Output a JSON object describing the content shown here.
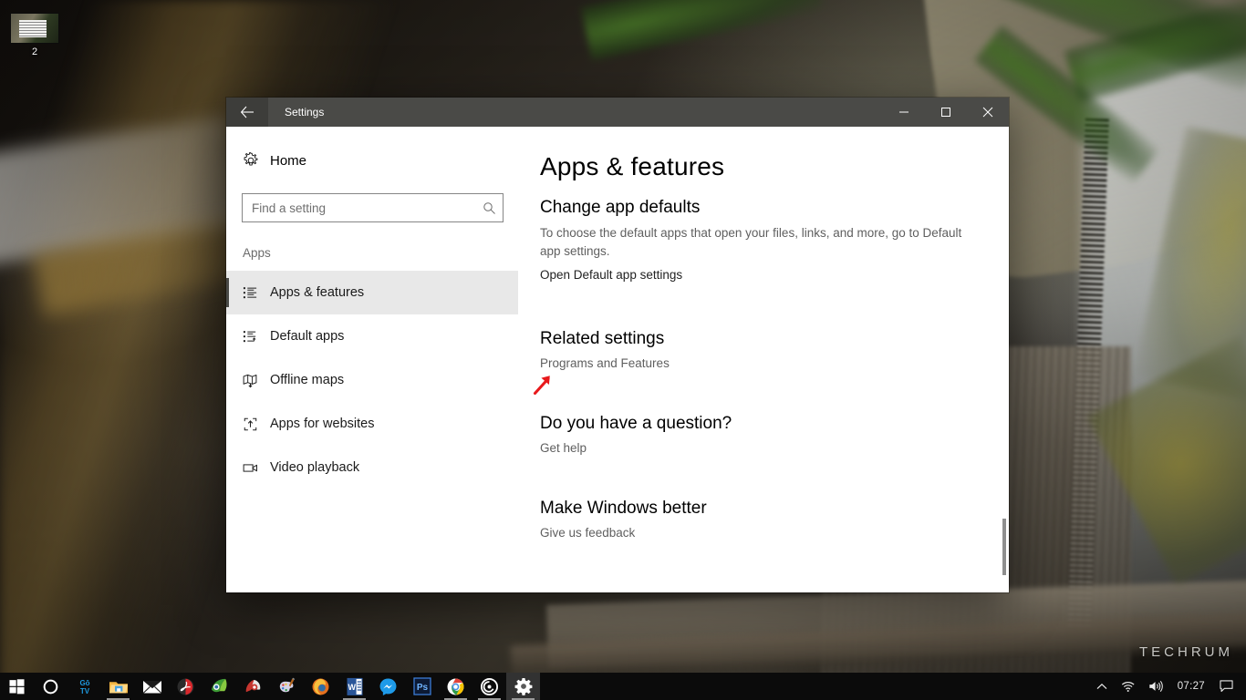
{
  "desktop": {
    "icon": {
      "label": "2",
      "name": "image-thumbnail"
    },
    "watermark": "TECHRUM"
  },
  "window": {
    "title": "Settings",
    "back_tooltip": "Back",
    "minimize_tooltip": "Minimize",
    "maximize_tooltip": "Maximize",
    "close_tooltip": "Close"
  },
  "sidebar": {
    "home_label": "Home",
    "search": {
      "placeholder": "Find a setting",
      "value": ""
    },
    "group_label": "Apps",
    "items": [
      {
        "label": "Apps & features",
        "icon": "list-icon",
        "selected": true
      },
      {
        "label": "Default apps",
        "icon": "list-arrow-icon",
        "selected": false
      },
      {
        "label": "Offline maps",
        "icon": "map-download-icon",
        "selected": false
      },
      {
        "label": "Apps for websites",
        "icon": "box-arrow-up-icon",
        "selected": false
      },
      {
        "label": "Video playback",
        "icon": "video-camera-icon",
        "selected": false
      }
    ]
  },
  "content": {
    "page_title": "Apps & features",
    "sections": [
      {
        "heading": "Change app defaults",
        "body": "To choose the default apps that open your files, links, and more, go to Default app settings.",
        "link": "Open Default app settings"
      },
      {
        "heading": "Related settings",
        "body": "",
        "link": "Programs and Features"
      },
      {
        "heading": "Do you have a question?",
        "body": "",
        "link": "Get help"
      },
      {
        "heading": "Make Windows better",
        "body": "",
        "link": "Give us feedback"
      }
    ],
    "annotation": {
      "name": "red-arrow-annotation",
      "color": "#e8191c"
    }
  },
  "taskbar": {
    "start_label": "Start",
    "cortana_label": "Cortana",
    "apps": [
      {
        "name": "gotv-icon",
        "label": "GoTV",
        "running": false,
        "active": false
      },
      {
        "name": "file-explorer-icon",
        "label": "File Explorer",
        "running": true,
        "active": false
      },
      {
        "name": "mail-icon",
        "label": "Mail",
        "running": false,
        "active": false
      },
      {
        "name": "adobe-acrobat-icon",
        "label": "Adobe Acrobat",
        "running": false,
        "active": false
      },
      {
        "name": "nvidia-icon",
        "label": "NVIDIA",
        "running": false,
        "active": false
      },
      {
        "name": "ccleaner-icon",
        "label": "CCleaner",
        "running": false,
        "active": false
      },
      {
        "name": "paint-icon",
        "label": "Paint",
        "running": false,
        "active": false
      },
      {
        "name": "firefox-icon",
        "label": "Firefox",
        "running": false,
        "active": false
      },
      {
        "name": "word-icon",
        "label": "Word",
        "running": true,
        "active": false
      },
      {
        "name": "messenger-icon",
        "label": "Messenger",
        "running": false,
        "active": false
      },
      {
        "name": "photoshop-icon",
        "label": "Photoshop",
        "running": false,
        "active": false
      },
      {
        "name": "chrome-icon",
        "label": "Google Chrome",
        "running": true,
        "active": false
      },
      {
        "name": "camera-shutter-icon",
        "label": "Screen Recorder",
        "running": true,
        "active": false
      },
      {
        "name": "settings-gear-icon",
        "label": "Settings",
        "running": true,
        "active": true
      }
    ],
    "tray": {
      "show_hidden_label": "Show hidden icons",
      "network_label": "Network",
      "volume_label": "Volume",
      "clock": "07:27",
      "action_center_label": "Action Center"
    }
  }
}
